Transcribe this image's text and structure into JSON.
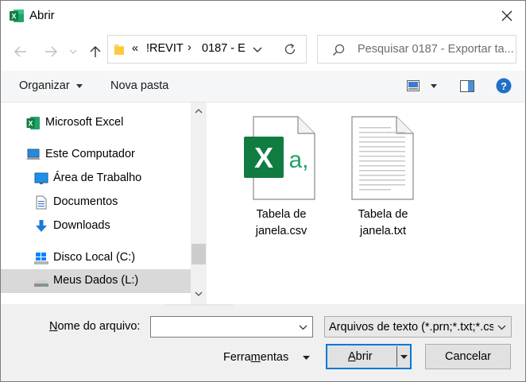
{
  "window": {
    "title": "Abrir",
    "app_icon": "excel-icon"
  },
  "nav": {
    "back_icon": "arrow-left-icon",
    "forward_icon": "arrow-right-icon",
    "recent_icon": "chevron-down-icon",
    "up_icon": "arrow-up-icon",
    "breadcrumb": {
      "overflow": "«",
      "seg1": "!REVIT",
      "sep": "›",
      "seg2": "0187 - E"
    },
    "refresh_icon": "refresh-icon",
    "search_placeholder": "Pesquisar 0187 - Exportar ta..."
  },
  "toolbar": {
    "organize": "Organizar",
    "new_folder": "Nova pasta",
    "view_icon": "view-options-icon",
    "preview_icon": "preview-pane-icon",
    "help_icon": "help-icon"
  },
  "sidebar": {
    "items": [
      {
        "label": "Microsoft Excel",
        "icon": "excel-icon"
      },
      {
        "label": "Este Computador",
        "icon": "computer-icon"
      },
      {
        "label": "Área de Trabalho",
        "icon": "desktop-icon"
      },
      {
        "label": "Documentos",
        "icon": "documents-icon"
      },
      {
        "label": "Downloads",
        "icon": "download-icon"
      },
      {
        "label": "Disco Local (C:)",
        "icon": "windows-drive-icon"
      },
      {
        "label": "Meus Dados (L:)",
        "icon": "drive-icon"
      }
    ]
  },
  "files": [
    {
      "line1": "Tabela de",
      "line2": "janela.csv",
      "icon": "excel-csv-file-icon",
      "glyph_x": "X",
      "glyph_a": "a,"
    },
    {
      "line1": "Tabela de",
      "line2": "janela.txt",
      "icon": "text-file-icon"
    }
  ],
  "footer": {
    "filename_label_u": "N",
    "filename_label_rest": "ome do arquivo:",
    "filename_value": "",
    "filetype": "Arquivos de texto (*.prn;*.txt;*.csv)",
    "tools_pre": "Ferra",
    "tools_u": "m",
    "tools_post": "entas",
    "open_u": "A",
    "open_rest": "brir",
    "cancel": "Cancelar"
  }
}
